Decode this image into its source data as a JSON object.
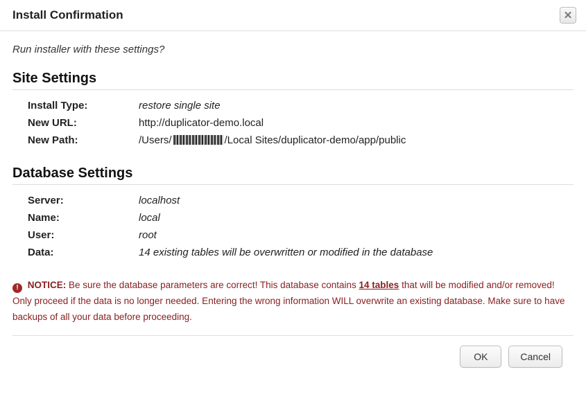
{
  "dialog": {
    "title": "Install Confirmation",
    "prompt": "Run installer with these settings?"
  },
  "site_settings": {
    "heading": "Site Settings",
    "install_type": {
      "label": "Install Type:",
      "value": "restore single site"
    },
    "new_url": {
      "label": "New URL:",
      "value": "http://duplicator-demo.local"
    },
    "new_path": {
      "label": "New Path:",
      "prefix": "/Users/",
      "suffix": "/Local Sites/duplicator-demo/app/public"
    }
  },
  "db_settings": {
    "heading": "Database Settings",
    "server": {
      "label": "Server:",
      "value": "localhost"
    },
    "name": {
      "label": "Name:",
      "value": "local"
    },
    "user": {
      "label": "User:",
      "value": "root"
    },
    "data": {
      "label": "Data:",
      "value": "14 existing tables will be overwritten or modified in the database"
    }
  },
  "notice": {
    "lead": "NOTICE:",
    "part1": " Be sure the database parameters are correct! This database contains ",
    "tables_link": "14 tables",
    "part2": " that will be modified and/or removed! Only proceed if the data is no longer needed. Entering the wrong information WILL overwrite an existing database. Make sure to have backups of all your data before proceeding."
  },
  "buttons": {
    "ok": "OK",
    "cancel": "Cancel"
  }
}
